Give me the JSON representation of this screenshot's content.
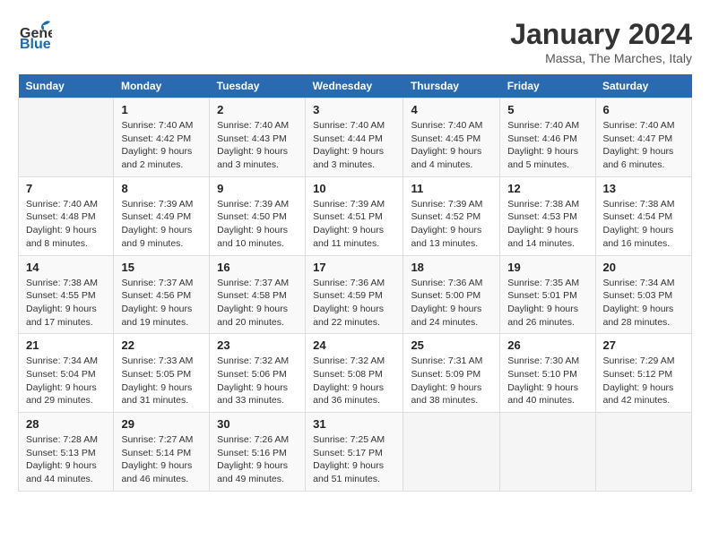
{
  "logo": {
    "general": "General",
    "blue": "Blue"
  },
  "header": {
    "month": "January 2024",
    "location": "Massa, The Marches, Italy"
  },
  "weekdays": [
    "Sunday",
    "Monday",
    "Tuesday",
    "Wednesday",
    "Thursday",
    "Friday",
    "Saturday"
  ],
  "weeks": [
    [
      {
        "day": null
      },
      {
        "day": 1,
        "sunrise": "7:40 AM",
        "sunset": "4:42 PM",
        "daylight": "9 hours and 2 minutes."
      },
      {
        "day": 2,
        "sunrise": "7:40 AM",
        "sunset": "4:43 PM",
        "daylight": "9 hours and 3 minutes."
      },
      {
        "day": 3,
        "sunrise": "7:40 AM",
        "sunset": "4:44 PM",
        "daylight": "9 hours and 3 minutes."
      },
      {
        "day": 4,
        "sunrise": "7:40 AM",
        "sunset": "4:45 PM",
        "daylight": "9 hours and 4 minutes."
      },
      {
        "day": 5,
        "sunrise": "7:40 AM",
        "sunset": "4:46 PM",
        "daylight": "9 hours and 5 minutes."
      },
      {
        "day": 6,
        "sunrise": "7:40 AM",
        "sunset": "4:47 PM",
        "daylight": "9 hours and 6 minutes."
      }
    ],
    [
      {
        "day": 7,
        "sunrise": "7:40 AM",
        "sunset": "4:48 PM",
        "daylight": "9 hours and 8 minutes."
      },
      {
        "day": 8,
        "sunrise": "7:39 AM",
        "sunset": "4:49 PM",
        "daylight": "9 hours and 9 minutes."
      },
      {
        "day": 9,
        "sunrise": "7:39 AM",
        "sunset": "4:50 PM",
        "daylight": "9 hours and 10 minutes."
      },
      {
        "day": 10,
        "sunrise": "7:39 AM",
        "sunset": "4:51 PM",
        "daylight": "9 hours and 11 minutes."
      },
      {
        "day": 11,
        "sunrise": "7:39 AM",
        "sunset": "4:52 PM",
        "daylight": "9 hours and 13 minutes."
      },
      {
        "day": 12,
        "sunrise": "7:38 AM",
        "sunset": "4:53 PM",
        "daylight": "9 hours and 14 minutes."
      },
      {
        "day": 13,
        "sunrise": "7:38 AM",
        "sunset": "4:54 PM",
        "daylight": "9 hours and 16 minutes."
      }
    ],
    [
      {
        "day": 14,
        "sunrise": "7:38 AM",
        "sunset": "4:55 PM",
        "daylight": "9 hours and 17 minutes."
      },
      {
        "day": 15,
        "sunrise": "7:37 AM",
        "sunset": "4:56 PM",
        "daylight": "9 hours and 19 minutes."
      },
      {
        "day": 16,
        "sunrise": "7:37 AM",
        "sunset": "4:58 PM",
        "daylight": "9 hours and 20 minutes."
      },
      {
        "day": 17,
        "sunrise": "7:36 AM",
        "sunset": "4:59 PM",
        "daylight": "9 hours and 22 minutes."
      },
      {
        "day": 18,
        "sunrise": "7:36 AM",
        "sunset": "5:00 PM",
        "daylight": "9 hours and 24 minutes."
      },
      {
        "day": 19,
        "sunrise": "7:35 AM",
        "sunset": "5:01 PM",
        "daylight": "9 hours and 26 minutes."
      },
      {
        "day": 20,
        "sunrise": "7:34 AM",
        "sunset": "5:03 PM",
        "daylight": "9 hours and 28 minutes."
      }
    ],
    [
      {
        "day": 21,
        "sunrise": "7:34 AM",
        "sunset": "5:04 PM",
        "daylight": "9 hours and 29 minutes."
      },
      {
        "day": 22,
        "sunrise": "7:33 AM",
        "sunset": "5:05 PM",
        "daylight": "9 hours and 31 minutes."
      },
      {
        "day": 23,
        "sunrise": "7:32 AM",
        "sunset": "5:06 PM",
        "daylight": "9 hours and 33 minutes."
      },
      {
        "day": 24,
        "sunrise": "7:32 AM",
        "sunset": "5:08 PM",
        "daylight": "9 hours and 36 minutes."
      },
      {
        "day": 25,
        "sunrise": "7:31 AM",
        "sunset": "5:09 PM",
        "daylight": "9 hours and 38 minutes."
      },
      {
        "day": 26,
        "sunrise": "7:30 AM",
        "sunset": "5:10 PM",
        "daylight": "9 hours and 40 minutes."
      },
      {
        "day": 27,
        "sunrise": "7:29 AM",
        "sunset": "5:12 PM",
        "daylight": "9 hours and 42 minutes."
      }
    ],
    [
      {
        "day": 28,
        "sunrise": "7:28 AM",
        "sunset": "5:13 PM",
        "daylight": "9 hours and 44 minutes."
      },
      {
        "day": 29,
        "sunrise": "7:27 AM",
        "sunset": "5:14 PM",
        "daylight": "9 hours and 46 minutes."
      },
      {
        "day": 30,
        "sunrise": "7:26 AM",
        "sunset": "5:16 PM",
        "daylight": "9 hours and 49 minutes."
      },
      {
        "day": 31,
        "sunrise": "7:25 AM",
        "sunset": "5:17 PM",
        "daylight": "9 hours and 51 minutes."
      },
      {
        "day": null
      },
      {
        "day": null
      },
      {
        "day": null
      }
    ]
  ]
}
